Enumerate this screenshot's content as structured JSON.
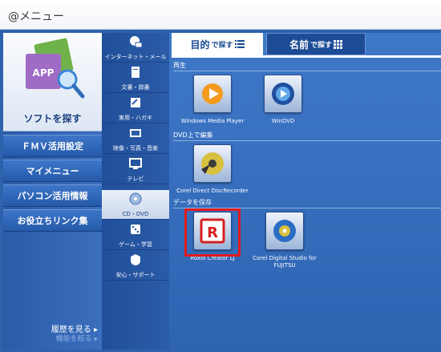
{
  "window": {
    "title": "@メニュー"
  },
  "sidebar": {
    "hero_label": "ソフトを探す",
    "hero_icon": "app-search-icon",
    "buttons": [
      {
        "label": "ＦＭＶ活用設定"
      },
      {
        "label": "マイメニュー"
      },
      {
        "label": "パソコン活用情報"
      },
      {
        "label": "お役立ちリンク集"
      }
    ],
    "history_label": "履歴を見る ▸",
    "history_sub": "機能を絞る ▸"
  },
  "categories": [
    {
      "label": "インターネット・メール",
      "icon": "internet-mail-icon",
      "active": false
    },
    {
      "label": "文書・辞書",
      "icon": "document-icon",
      "active": false
    },
    {
      "label": "実用・ハガキ",
      "icon": "postcard-icon",
      "active": false
    },
    {
      "label": "映像・写真・音楽",
      "icon": "media-icon",
      "active": false
    },
    {
      "label": "テレビ",
      "icon": "tv-icon",
      "active": false
    },
    {
      "label": "CD・DVD",
      "icon": "disc-icon",
      "active": true
    },
    {
      "label": "ゲーム・学習",
      "icon": "game-icon",
      "active": false
    },
    {
      "label": "安心・サポート",
      "icon": "support-icon",
      "active": false
    }
  ],
  "tabs": {
    "purpose": {
      "main": "目的",
      "sub": "で探す",
      "icon": "list-icon"
    },
    "name": {
      "main": "名前",
      "sub": "で探す",
      "icon": "grid-icon"
    }
  },
  "sections": [
    {
      "label": "再生"
    },
    {
      "label": "DVD上で編集"
    },
    {
      "label": "データを保存"
    }
  ],
  "apps": [
    {
      "name": "Windows Media Player",
      "icon": "windows-media-player-icon"
    },
    {
      "name": "WinDVD",
      "icon": "windvd-icon"
    },
    {
      "name": "Corel Direct DiscRecorder",
      "icon": "corel-disc-recorder-icon"
    },
    {
      "name": "Roxio Creator LJ",
      "icon": "roxio-creator-icon",
      "highlighted": true
    },
    {
      "name": "Corel Digital Studio for FUJITSU",
      "icon": "corel-digital-studio-icon"
    }
  ],
  "colors": {
    "frame": "#2e62ad",
    "highlight": "#e21b1b",
    "roxio_red": "#d42020"
  }
}
